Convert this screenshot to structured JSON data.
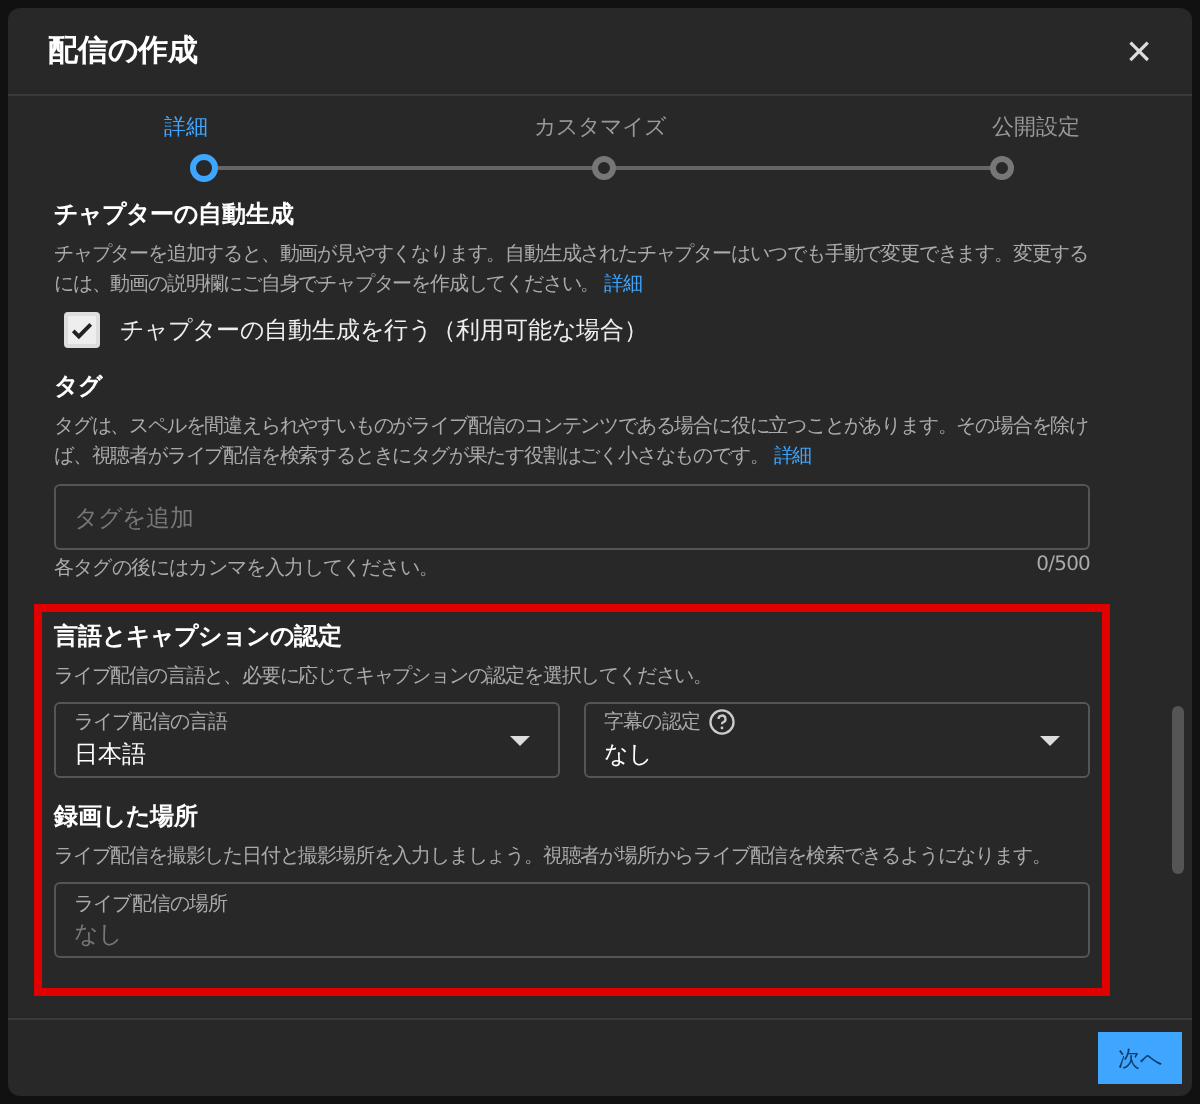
{
  "dialog": {
    "title": "配信の作成",
    "close": "×"
  },
  "steps": [
    {
      "label": "詳細",
      "selected": true
    },
    {
      "label": "カスタマイズ",
      "selected": false
    },
    {
      "label": "公開設定",
      "selected": false
    }
  ],
  "chapters": {
    "title": "チャプターの自動生成",
    "description": "チャプターを追加すると、動画が見やすくなります。自動生成されたチャプターはいつでも手動で変更できます。変更するには、動画の説明欄にご自身でチャプターを作成してください。",
    "link": "詳細",
    "checkbox": {
      "label": "チャプターの自動生成を行う（利用可能な場合）",
      "checked": true
    }
  },
  "tags": {
    "title": "タグ",
    "description": "タグは、スペルを間違えられやすいものがライブ配信のコンテンツである場合に役に立つことがあります。その場合を除けば、視聴者がライブ配信を検索するときにタグが果たす役割はごく小さなものです。",
    "link": "詳細",
    "placeholder": "タグを追加",
    "hint": "各タグの後にはカンマを入力してください。",
    "count": "0/500"
  },
  "highlighted_sections": {
    "highlighted": true,
    "language": {
      "title": "言語とキャプションの認定",
      "description": "ライブ配信の言語と、必要に応じてキャプションの認定を選択してください。",
      "selects": [
        {
          "label": "ライブ配信の言語",
          "value": "日本語",
          "help": false
        },
        {
          "label": "字幕の認定",
          "value": "なし",
          "help": true
        }
      ]
    },
    "location": {
      "title": "録画した場所",
      "description": "ライブ配信を撮影した日付と撮影場所を入力しましょう。視聴者が場所からライブ配信を検索できるようになります。",
      "field": {
        "label": "ライブ配信の場所",
        "placeholder": "なし"
      }
    }
  },
  "footer": {
    "next_button": "次へ"
  }
}
